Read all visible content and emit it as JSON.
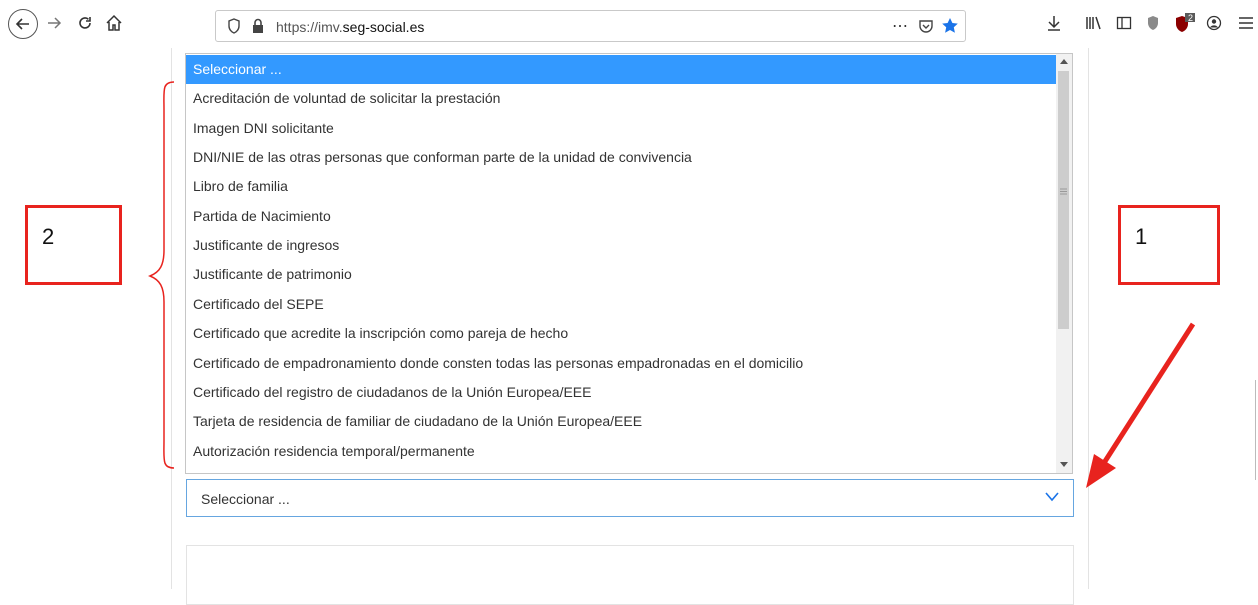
{
  "browser": {
    "url_prefix": "https://imv.",
    "url_domain": "seg-social.es",
    "more_label": "⋯",
    "addon_badge": "2",
    "icons": [
      "back-icon",
      "forward-icon",
      "reload-icon",
      "home-icon",
      "shield-icon",
      "lock-icon",
      "pocket-icon",
      "star-icon",
      "download-icon",
      "library-icon",
      "sidebar-icon",
      "privacy-icon",
      "ublock-icon",
      "account-icon",
      "menu-icon"
    ]
  },
  "listbox": {
    "options": [
      "Seleccionar ...",
      "Acreditación de voluntad de solicitar la prestación",
      "Imagen DNI solicitante",
      "DNI/NIE de las otras personas que conforman parte de la unidad de convivencia",
      "Libro de familia",
      "Partida de Nacimiento",
      "Justificante de ingresos",
      "Justificante de patrimonio",
      "Certificado del SEPE",
      "Certificado que acredite la inscripción como pareja de hecho",
      "Certificado de empadronamiento donde consten todas las personas empadronadas en el domicilio",
      "Certificado del registro de ciudadanos de la Unión Europea/EEE",
      "Tarjeta de residencia de familiar de ciudadano de la Unión Europea/EEE",
      "Autorización residencia temporal/permanente"
    ],
    "selected_index": 0,
    "selected_color": "#3399ff"
  },
  "select": {
    "value": "Seleccionar ..."
  },
  "annotations": {
    "label_1": "1",
    "label_2": "2",
    "color": "#e8231e"
  }
}
